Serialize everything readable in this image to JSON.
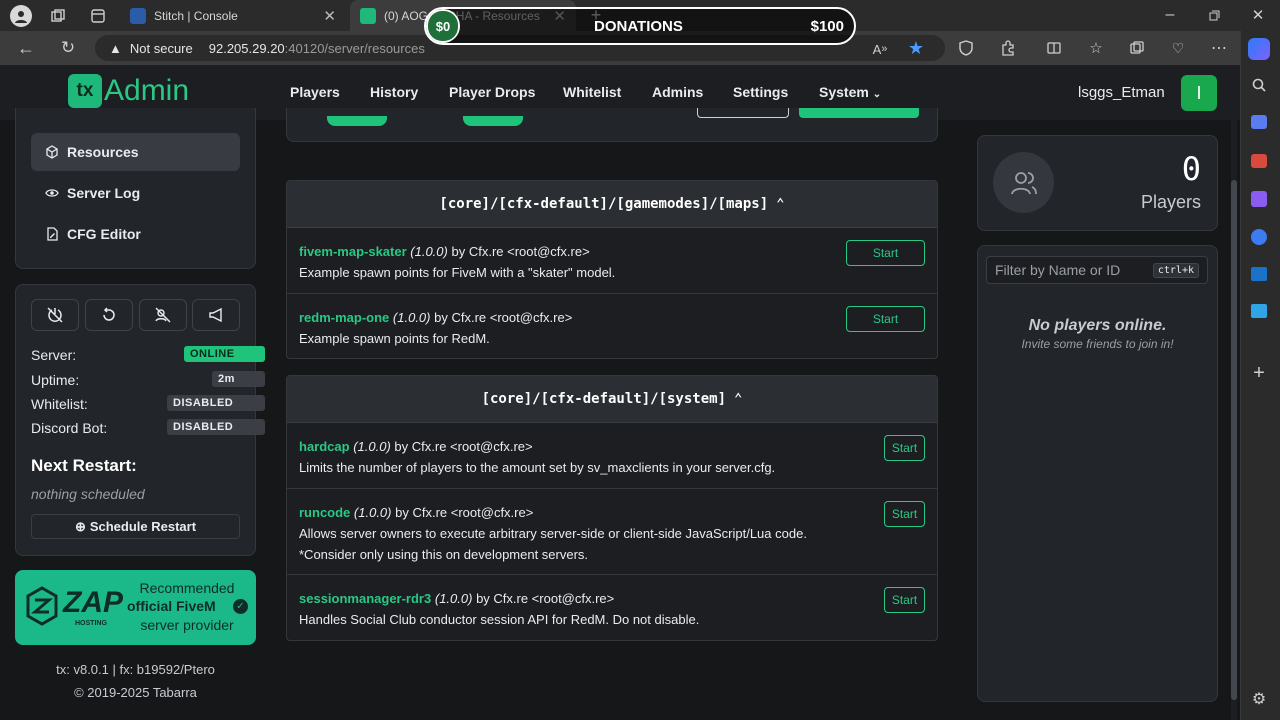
{
  "browser": {
    "tabs": [
      {
        "label": "Stitch | Console",
        "active": false
      },
      {
        "label": "(0) AOG T...CHA - Resources",
        "active": true
      }
    ],
    "address": {
      "security": "Not secure",
      "host": "92.205.29.20",
      "path": ":40120/server/resources"
    }
  },
  "overlay": {
    "amount_left": "$0",
    "label": "DONATIONS",
    "amount_right": "$100"
  },
  "header": {
    "logo_badge": "tx",
    "logo_text": "Admin",
    "nav": [
      "Players",
      "History",
      "Player Drops",
      "Whitelist",
      "Admins",
      "Settings",
      "System"
    ],
    "username": "lsggs_Etman",
    "avatar_letter": "I"
  },
  "sidebar": {
    "menu": [
      {
        "label": "Resources",
        "icon": "cube-icon"
      },
      {
        "label": "Server Log",
        "icon": "eye-icon"
      },
      {
        "label": "CFG Editor",
        "icon": "file-edit-icon"
      }
    ],
    "status": [
      {
        "label": "Server:",
        "value": "ONLINE"
      },
      {
        "label": "Uptime:",
        "value": "2m"
      },
      {
        "label": "Whitelist:",
        "value": "DISABLED"
      },
      {
        "label": "Discord Bot:",
        "value": "DISABLED"
      }
    ],
    "next_restart_title": "Next Restart:",
    "next_restart_value": "nothing scheduled",
    "schedule_button": "Schedule Restart",
    "ad": {
      "brand": "ZAP",
      "sub": "HOSTING",
      "line1": "Recommended",
      "line2": "official FiveM",
      "line3": "server provider"
    },
    "footer_version": "tx: v8.0.1 | fx: b19592/Ptero",
    "footer_copyright": "© 2019-2025 Tabarra"
  },
  "groups": [
    {
      "title": "[core]/[cfx-default]/[gamemodes]/[maps]",
      "resources": [
        {
          "name": "fivem-map-skater",
          "version": "(1.0.0)",
          "author": "by Cfx.re <root@cfx.re>",
          "description": "Example spawn points for FiveM with a \"skater\" model.",
          "button": "Start"
        },
        {
          "name": "redm-map-one",
          "version": "(1.0.0)",
          "author": "by Cfx.re <root@cfx.re>",
          "description": "Example spawn points for RedM.",
          "button": "Start"
        }
      ]
    },
    {
      "title": "[core]/[cfx-default]/[system]",
      "resources": [
        {
          "name": "hardcap",
          "version": "(1.0.0)",
          "author": "by Cfx.re <root@cfx.re>",
          "description": "Limits the number of players to the amount set by sv_maxclients in your server.cfg.",
          "button": "Start"
        },
        {
          "name": "runcode",
          "version": "(1.0.0)",
          "author": "by Cfx.re <root@cfx.re>",
          "description": "Allows server owners to execute arbitrary server-side or client-side JavaScript/Lua code.",
          "description2": "*Consider only using this on development servers.",
          "button": "Start"
        },
        {
          "name": "sessionmanager-rdr3",
          "version": "(1.0.0)",
          "author": "by Cfx.re <root@cfx.re>",
          "description": "Handles Social Club conductor session API for RedM. Do not disable.",
          "button": "Start"
        }
      ]
    }
  ],
  "players_panel": {
    "count": "0",
    "label": "Players",
    "filter_placeholder": "Filter by Name or ID",
    "shortcut": "ctrl+k",
    "empty_title": "No players online.",
    "empty_sub": "Invite some friends to join in!"
  },
  "colors": {
    "accent": "#29c985",
    "online": "#1fc47a",
    "ad_bg": "#1bb98a"
  }
}
